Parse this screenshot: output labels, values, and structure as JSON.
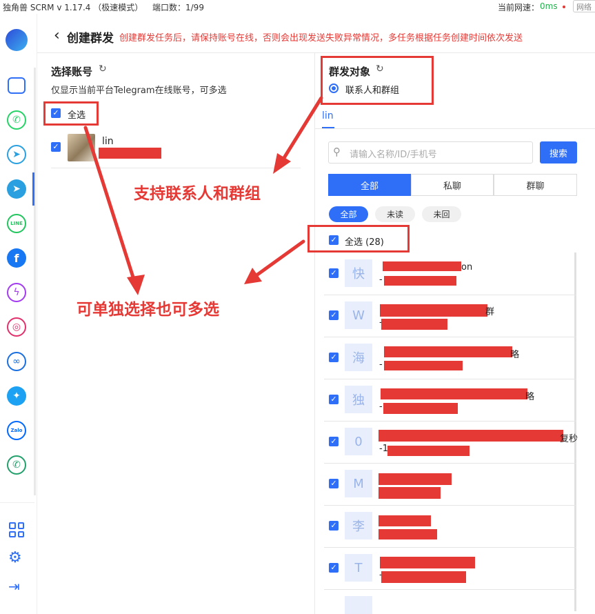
{
  "topbar": {
    "app_title": "独角兽 SCRM v 1.17.4  （极速模式）",
    "port_label": "端口数：1/99",
    "speed_label": "当前网速：",
    "speed_value": "0ms",
    "network_btn": "网络"
  },
  "sidebar": {
    "icons": [
      "unicorn-logo-icon",
      "home-icon",
      "whatsapp-icon",
      "telegram-alt-icon",
      "telegram-icon",
      "line-icon",
      "facebook-icon",
      "messenger-icon",
      "instagram-icon",
      "meta-icon",
      "twitter-icon",
      "zalo-icon",
      "viber-icon",
      "apps-grid-icon",
      "settings-icon",
      "logout-icon"
    ],
    "line_text": "LINE",
    "zalo_text": "Zalo"
  },
  "header": {
    "back_title": "创建群发",
    "notice": "创建群发任务后，请保持账号在线，否则会出现发送失败异常情况，多任务根据任务创建时间依次发送"
  },
  "left_panel": {
    "title": "选择账号",
    "subtitle": "仅显示当前平台Telegram在线账号，可多选",
    "select_all": "全选",
    "account_name": "lin"
  },
  "right_panel": {
    "title": "群发对象",
    "radio_label": "联系人和群组",
    "account_tab": "lin",
    "search_placeholder": "请输入名称/ID/手机号",
    "search_button": "搜索",
    "seg_tabs": [
      "全部",
      "私聊",
      "群聊"
    ],
    "filter_pills": [
      "全部",
      "未读",
      "未回"
    ],
    "select_all_count": "全选 (28)",
    "contacts": [
      {
        "avatar": "快",
        "name_tail": "on",
        "id_prefix": "-"
      },
      {
        "avatar": "W",
        "name_tail": "群",
        "id_prefix": "-"
      },
      {
        "avatar": "海",
        "name_tail": "略",
        "id_prefix": "-"
      },
      {
        "avatar": "独",
        "name_tail": "略",
        "id_prefix": "-"
      },
      {
        "avatar": "0",
        "name_tail": "复秒",
        "id_prefix": "-1"
      },
      {
        "avatar": "M",
        "name_tail": "",
        "id_prefix": ""
      },
      {
        "avatar": "李",
        "name_tail": "",
        "id_prefix": ""
      },
      {
        "avatar": "T",
        "name_tail": "",
        "id_prefix": "-"
      }
    ]
  },
  "annotations": {
    "contacts_groups": "支持联系人和群组",
    "single_multi": "可单独选择也可多选"
  },
  "colors": {
    "accent": "#2f6ef6",
    "annotation_red": "#e53935"
  }
}
